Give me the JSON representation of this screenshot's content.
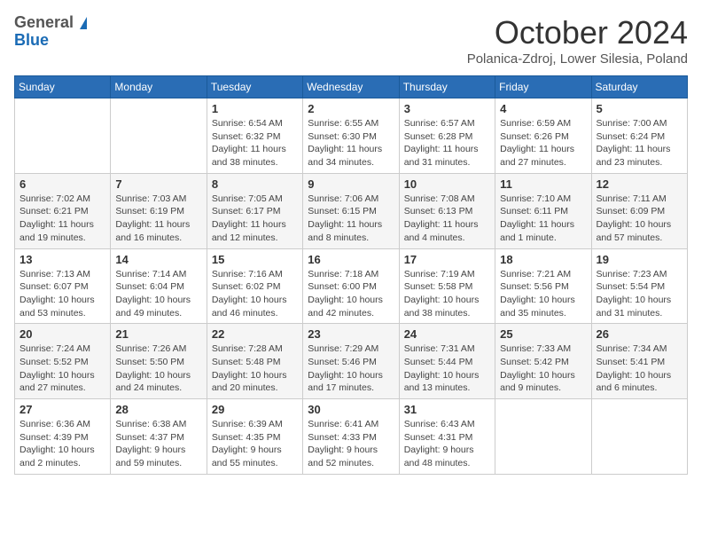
{
  "header": {
    "logo_line1": "General",
    "logo_line2": "Blue",
    "month_title": "October 2024",
    "subtitle": "Polanica-Zdroj, Lower Silesia, Poland"
  },
  "days_of_week": [
    "Sunday",
    "Monday",
    "Tuesday",
    "Wednesday",
    "Thursday",
    "Friday",
    "Saturday"
  ],
  "weeks": [
    [
      {
        "day": "",
        "info": ""
      },
      {
        "day": "",
        "info": ""
      },
      {
        "day": "1",
        "info": "Sunrise: 6:54 AM\nSunset: 6:32 PM\nDaylight: 11 hours and 38 minutes."
      },
      {
        "day": "2",
        "info": "Sunrise: 6:55 AM\nSunset: 6:30 PM\nDaylight: 11 hours and 34 minutes."
      },
      {
        "day": "3",
        "info": "Sunrise: 6:57 AM\nSunset: 6:28 PM\nDaylight: 11 hours and 31 minutes."
      },
      {
        "day": "4",
        "info": "Sunrise: 6:59 AM\nSunset: 6:26 PM\nDaylight: 11 hours and 27 minutes."
      },
      {
        "day": "5",
        "info": "Sunrise: 7:00 AM\nSunset: 6:24 PM\nDaylight: 11 hours and 23 minutes."
      }
    ],
    [
      {
        "day": "6",
        "info": "Sunrise: 7:02 AM\nSunset: 6:21 PM\nDaylight: 11 hours and 19 minutes."
      },
      {
        "day": "7",
        "info": "Sunrise: 7:03 AM\nSunset: 6:19 PM\nDaylight: 11 hours and 16 minutes."
      },
      {
        "day": "8",
        "info": "Sunrise: 7:05 AM\nSunset: 6:17 PM\nDaylight: 11 hours and 12 minutes."
      },
      {
        "day": "9",
        "info": "Sunrise: 7:06 AM\nSunset: 6:15 PM\nDaylight: 11 hours and 8 minutes."
      },
      {
        "day": "10",
        "info": "Sunrise: 7:08 AM\nSunset: 6:13 PM\nDaylight: 11 hours and 4 minutes."
      },
      {
        "day": "11",
        "info": "Sunrise: 7:10 AM\nSunset: 6:11 PM\nDaylight: 11 hours and 1 minute."
      },
      {
        "day": "12",
        "info": "Sunrise: 7:11 AM\nSunset: 6:09 PM\nDaylight: 10 hours and 57 minutes."
      }
    ],
    [
      {
        "day": "13",
        "info": "Sunrise: 7:13 AM\nSunset: 6:07 PM\nDaylight: 10 hours and 53 minutes."
      },
      {
        "day": "14",
        "info": "Sunrise: 7:14 AM\nSunset: 6:04 PM\nDaylight: 10 hours and 49 minutes."
      },
      {
        "day": "15",
        "info": "Sunrise: 7:16 AM\nSunset: 6:02 PM\nDaylight: 10 hours and 46 minutes."
      },
      {
        "day": "16",
        "info": "Sunrise: 7:18 AM\nSunset: 6:00 PM\nDaylight: 10 hours and 42 minutes."
      },
      {
        "day": "17",
        "info": "Sunrise: 7:19 AM\nSunset: 5:58 PM\nDaylight: 10 hours and 38 minutes."
      },
      {
        "day": "18",
        "info": "Sunrise: 7:21 AM\nSunset: 5:56 PM\nDaylight: 10 hours and 35 minutes."
      },
      {
        "day": "19",
        "info": "Sunrise: 7:23 AM\nSunset: 5:54 PM\nDaylight: 10 hours and 31 minutes."
      }
    ],
    [
      {
        "day": "20",
        "info": "Sunrise: 7:24 AM\nSunset: 5:52 PM\nDaylight: 10 hours and 27 minutes."
      },
      {
        "day": "21",
        "info": "Sunrise: 7:26 AM\nSunset: 5:50 PM\nDaylight: 10 hours and 24 minutes."
      },
      {
        "day": "22",
        "info": "Sunrise: 7:28 AM\nSunset: 5:48 PM\nDaylight: 10 hours and 20 minutes."
      },
      {
        "day": "23",
        "info": "Sunrise: 7:29 AM\nSunset: 5:46 PM\nDaylight: 10 hours and 17 minutes."
      },
      {
        "day": "24",
        "info": "Sunrise: 7:31 AM\nSunset: 5:44 PM\nDaylight: 10 hours and 13 minutes."
      },
      {
        "day": "25",
        "info": "Sunrise: 7:33 AM\nSunset: 5:42 PM\nDaylight: 10 hours and 9 minutes."
      },
      {
        "day": "26",
        "info": "Sunrise: 7:34 AM\nSunset: 5:41 PM\nDaylight: 10 hours and 6 minutes."
      }
    ],
    [
      {
        "day": "27",
        "info": "Sunrise: 6:36 AM\nSunset: 4:39 PM\nDaylight: 10 hours and 2 minutes."
      },
      {
        "day": "28",
        "info": "Sunrise: 6:38 AM\nSunset: 4:37 PM\nDaylight: 9 hours and 59 minutes."
      },
      {
        "day": "29",
        "info": "Sunrise: 6:39 AM\nSunset: 4:35 PM\nDaylight: 9 hours and 55 minutes."
      },
      {
        "day": "30",
        "info": "Sunrise: 6:41 AM\nSunset: 4:33 PM\nDaylight: 9 hours and 52 minutes."
      },
      {
        "day": "31",
        "info": "Sunrise: 6:43 AM\nSunset: 4:31 PM\nDaylight: 9 hours and 48 minutes."
      },
      {
        "day": "",
        "info": ""
      },
      {
        "day": "",
        "info": ""
      }
    ]
  ]
}
